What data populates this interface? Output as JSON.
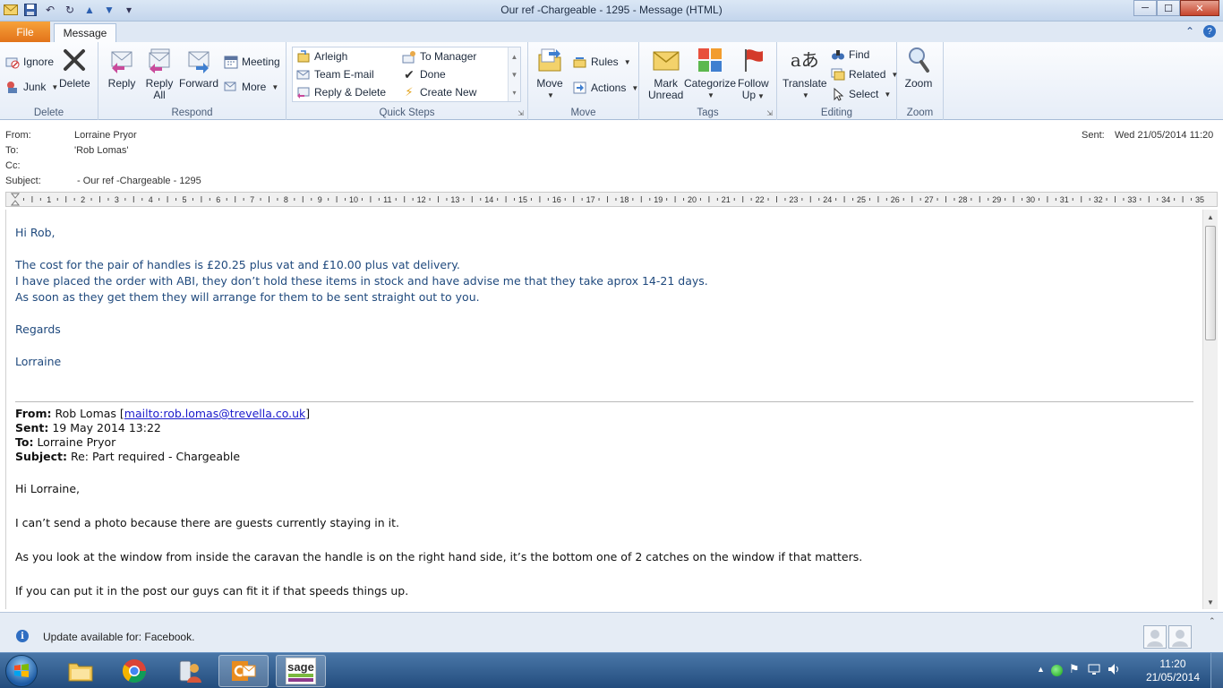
{
  "window": {
    "title": "Our ref -Chargeable - 1295  -  Message (HTML)",
    "min": "─",
    "max": "☐",
    "close": "✕"
  },
  "tabs": {
    "file": "File",
    "message": "Message"
  },
  "ribbon": {
    "delete_group": {
      "label": "Delete",
      "ignore": "Ignore",
      "junk": "Junk",
      "delete": "Delete"
    },
    "respond_group": {
      "label": "Respond",
      "reply": "Reply",
      "reply_all_1": "Reply",
      "reply_all_2": "All",
      "forward": "Forward",
      "meeting": "Meeting",
      "more": "More"
    },
    "quicksteps_group": {
      "label": "Quick Steps",
      "items": [
        "Arleigh",
        "To Manager",
        "Team E-mail",
        "Done",
        "Reply & Delete",
        "Create New"
      ]
    },
    "move_group": {
      "label": "Move",
      "move": "Move",
      "rules": "Rules",
      "actions": "Actions"
    },
    "tags_group": {
      "label": "Tags",
      "mark_unread_1": "Mark",
      "mark_unread_2": "Unread",
      "categorize": "Categorize",
      "follow_up_1": "Follow",
      "follow_up_2": "Up"
    },
    "editing_group": {
      "label": "Editing",
      "translate": "Translate",
      "find": "Find",
      "related": "Related",
      "select": "Select"
    },
    "zoom_group": {
      "label": "Zoom",
      "zoom": "Zoom"
    }
  },
  "header": {
    "from_label": "From:",
    "from": "Lorraine Pryor",
    "to_label": "To:",
    "to": "'Rob Lomas'",
    "cc_label": "Cc:",
    "cc": "",
    "subject_label": "Subject:",
    "subject": "-  Our ref -Chargeable - 1295",
    "sent_label": "Sent:",
    "sent": "Wed 21/05/2014 11:20"
  },
  "ruler": {
    "numbers": [
      "1",
      "2",
      "3",
      "4",
      "5",
      "6",
      "7",
      "8",
      "9",
      "10",
      "11",
      "12",
      "13",
      "14",
      "15",
      "16",
      "17",
      "18",
      "19",
      "20",
      "21",
      "22",
      "23",
      "24",
      "25",
      "26",
      "27",
      "28",
      "29",
      "30",
      "31",
      "32",
      "33",
      "34",
      "35"
    ]
  },
  "reply": {
    "greeting": "Hi Rob,",
    "line1": "The cost for the pair of handles is £20.25 plus vat and £10.00 plus vat delivery.",
    "line2": "I have placed the order with ABI,  they don’t hold these items in stock and have advise me that they take aprox 14-21 days.",
    "line3": "As soon as they get them they will arrange for them to be sent straight out to you.",
    "regards": "Regards",
    "signature": "Lorraine"
  },
  "original": {
    "from_label": "From:",
    "from_name": "Rob Lomas [",
    "from_link": "mailto:rob.lomas@trevella.co.uk",
    "from_end": "]",
    "sent_label": "Sent:",
    "sent": "19 May 2014 13:22",
    "to_label": "To:",
    "to": "Lorraine Pryor",
    "subject_label": "Subject:",
    "subject": "Re: Part required - Chargeable",
    "greeting": "Hi Lorraine,",
    "p1": "I can’t send a photo because there are guests currently staying in it.",
    "p2": "As you look at the window from inside the caravan the handle is on the right hand side, it’s the bottom one of 2 catches on the window if that matters.",
    "p3": "If you can put it in the post our guys can fit it if that speeds things up."
  },
  "status": {
    "text": "Update available for: Facebook."
  },
  "taskbar": {
    "time": "11:20",
    "date": "21/05/2014",
    "sage": "sage"
  },
  "colors": {
    "reply_text": "#1f497d",
    "file_tab": "#e2731a",
    "taskbar": "#234c7d"
  }
}
